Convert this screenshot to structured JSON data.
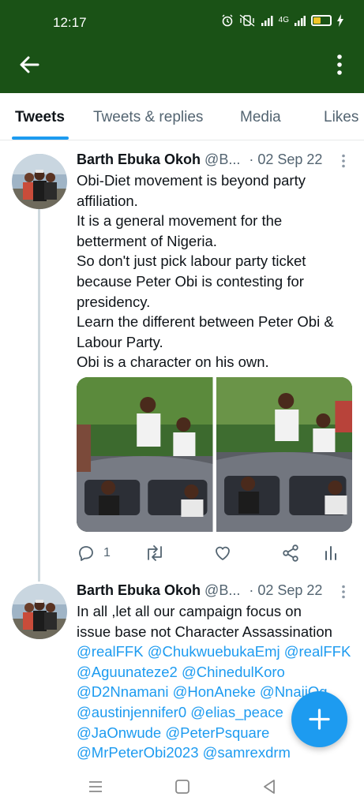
{
  "status_bar": {
    "time": "12:17",
    "network_label": "4G"
  },
  "header": {
    "back_icon": "arrow-left-icon",
    "more_icon": "kebab-menu-icon",
    "background": "#1a5216"
  },
  "tabs": [
    {
      "label": "Tweets",
      "active": true
    },
    {
      "label": "Tweets & replies",
      "active": false
    },
    {
      "label": "Media",
      "active": false
    },
    {
      "label": "Likes",
      "active": false
    }
  ],
  "tweets": [
    {
      "author": "Barth Ebuka Okoh",
      "handle": "@B...",
      "separator": "·",
      "date": "02 Sep 22",
      "lines": [
        "Obi-Diet movement is beyond party",
        "affiliation.",
        "It is a general movement for the",
        "betterment of Nigeria.",
        "So don't just pick labour party ticket",
        "because Peter Obi is contesting for",
        "presidency.",
        "Learn the different between Peter Obi &",
        "Labour Party.",
        "Obi is a character on his own."
      ],
      "reply_count": "1",
      "retweet_count": "",
      "like_count": ""
    },
    {
      "author": "Barth Ebuka Okoh",
      "handle": "@B...",
      "separator": "·",
      "date": "02 Sep 22",
      "lines": [
        "In all ,let all our campaign focus on",
        "issue base not Character Assassination"
      ],
      "mention_lines": [
        "@realFFK @ChukwuebukaEmj @realFFK",
        "@Aguunateze2 @ChinedulKoro",
        "@D2Nnamani @HonAneke @NnajiOg",
        "@austinjennifer0 @elias_peace",
        "@JaOnwude @PeterPsquare",
        "@MrPeterObi2023 @samrexdrm"
      ]
    }
  ],
  "fab": {
    "icon": "plus-icon",
    "color": "#1d9bf0"
  },
  "android_nav": [
    "menu-icon",
    "home-square-icon",
    "back-triangle-icon"
  ]
}
